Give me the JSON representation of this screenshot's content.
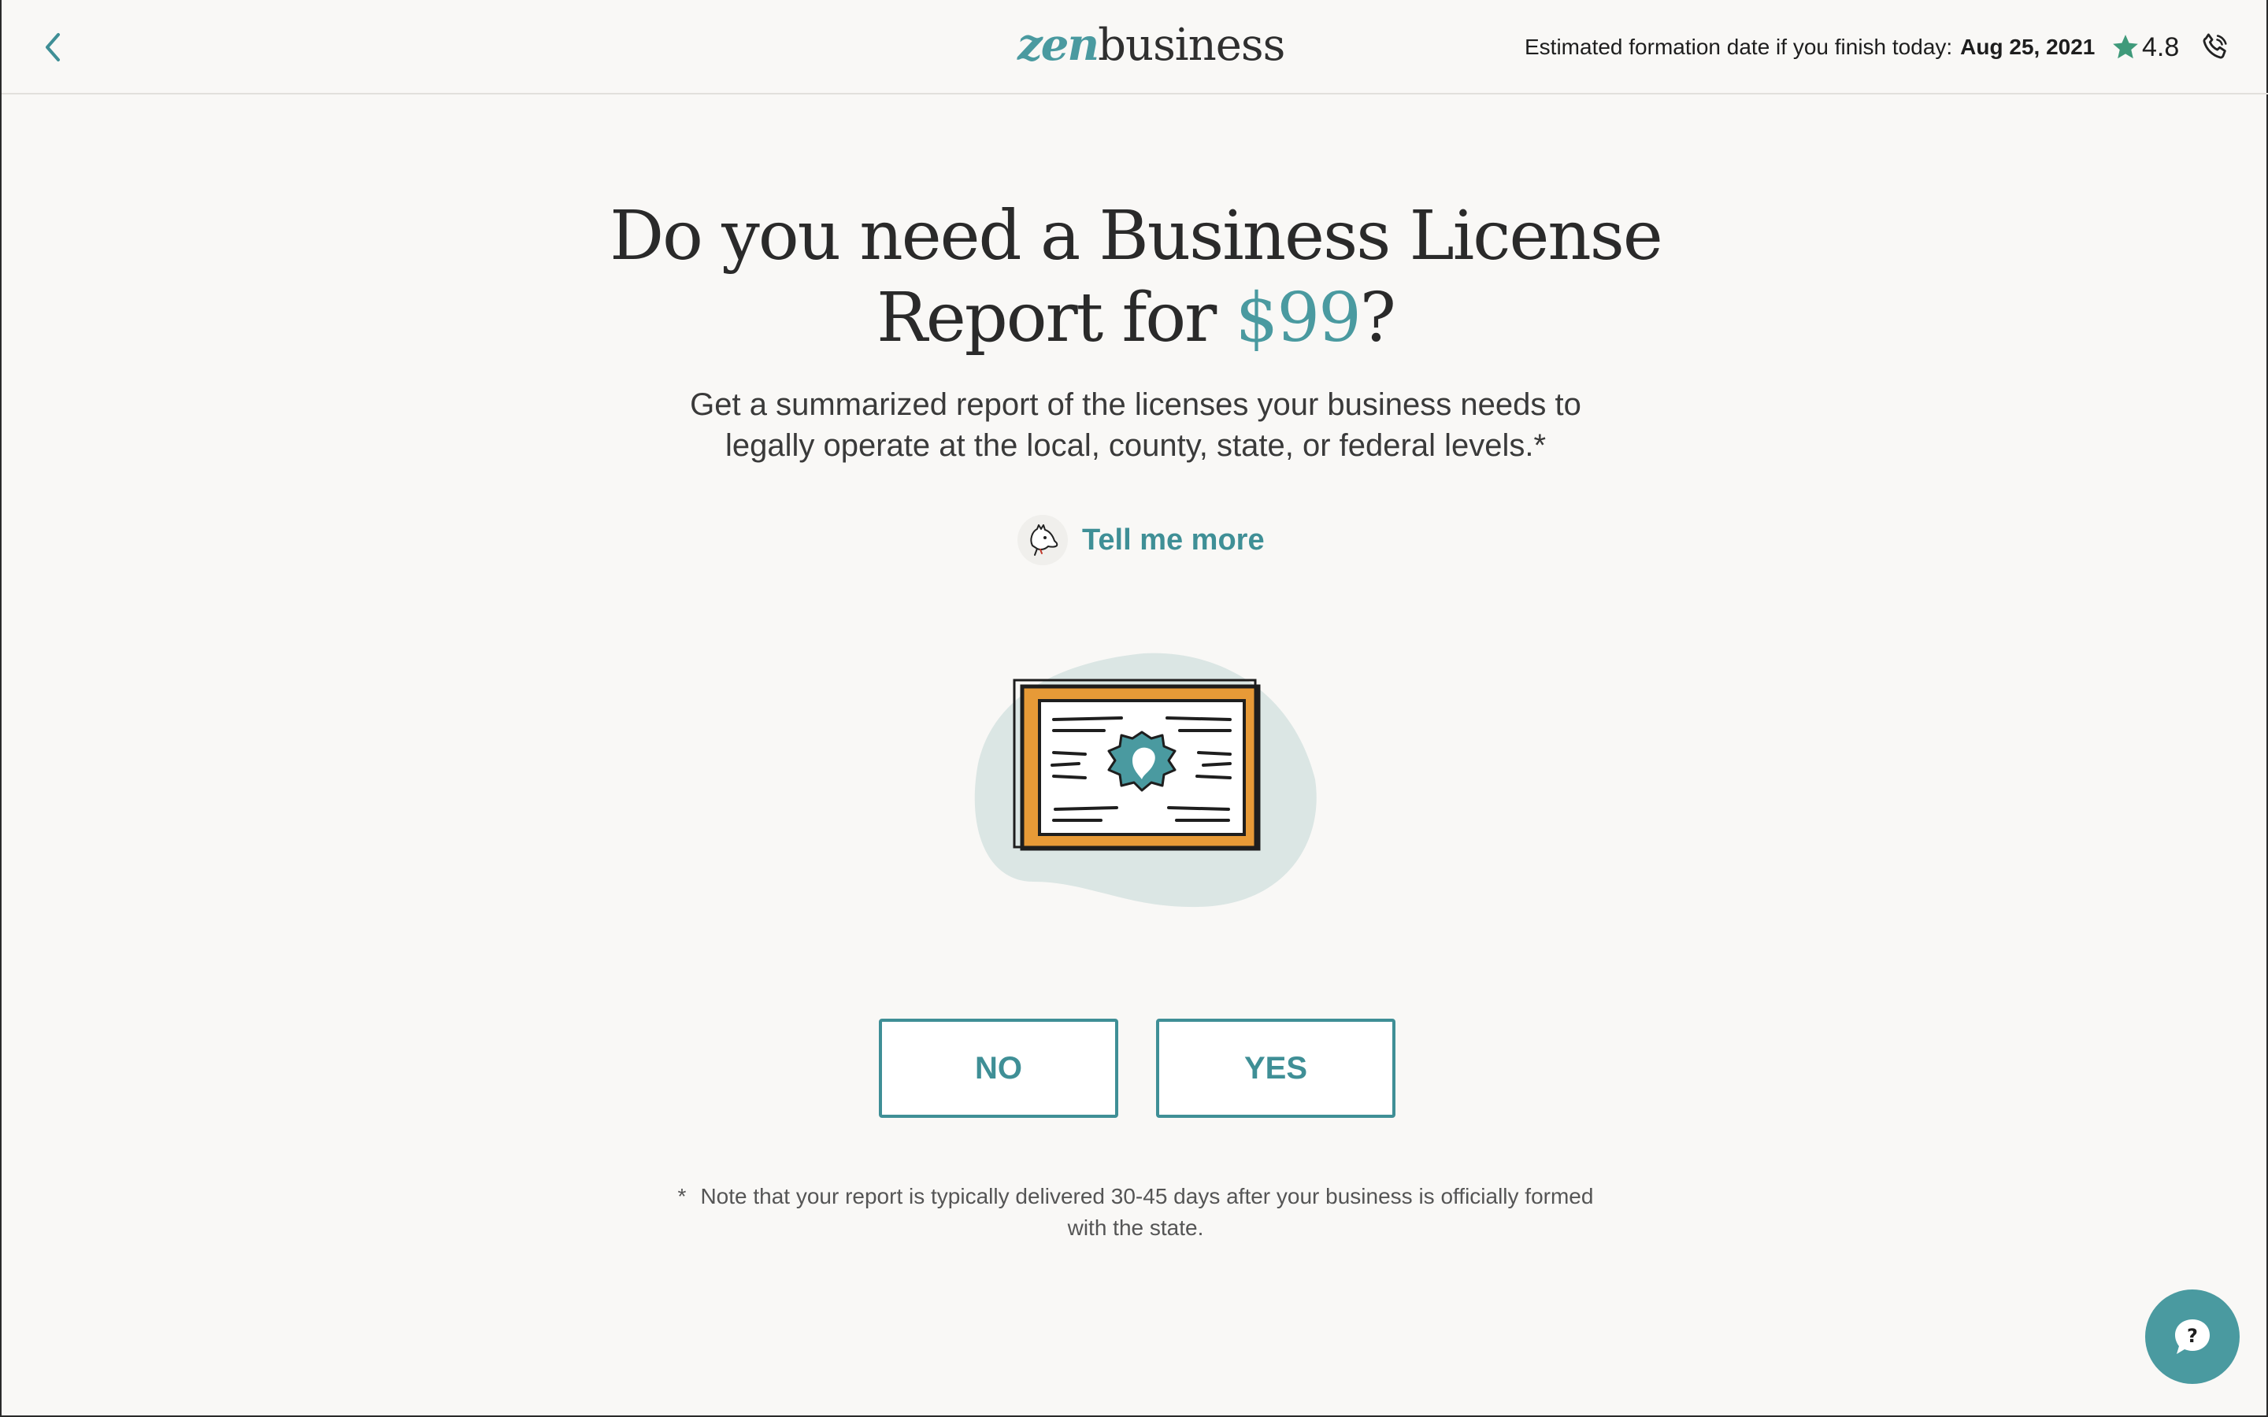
{
  "header": {
    "logo_zen": "zen",
    "logo_business": "business",
    "estimate_label": "Estimated formation date if you finish today:",
    "estimate_date": "Aug 25, 2021",
    "rating": "4.8",
    "star_color": "#3f9a7a"
  },
  "main": {
    "headline_part1": "Do you need a Business License Report for ",
    "headline_price": "$99",
    "headline_end": "?",
    "subtitle": "Get a summarized report of the licenses your business needs to legally operate at the local, county, state, or federal levels.*",
    "tell_more": "Tell me more",
    "no_label": "NO",
    "yes_label": "YES",
    "note_asterisk": "*",
    "note_text": "Note that your report is typically delivered 30-45 days after your business is officially formed with the state."
  },
  "colors": {
    "accent": "#3f8f96",
    "background": "#f9f8f6",
    "illustration_orange": "#e79a37",
    "illustration_blob": "#dbe6e4"
  },
  "icons": {
    "back": "chevron-left-icon",
    "star": "star-icon",
    "phone": "phone-icon",
    "dog": "dog-mascot-icon",
    "help": "question-chat-icon"
  }
}
